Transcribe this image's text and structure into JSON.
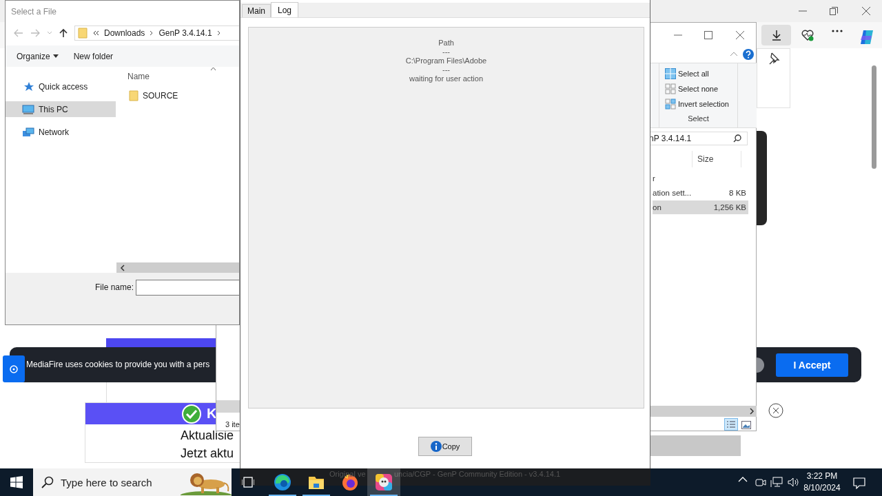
{
  "browser": {
    "cookie_banner": {
      "text": "MediaFire uses cookies to provide you with a pers",
      "accept_button": "I Accept"
    },
    "ad": {
      "headline": "K",
      "lines": [
        "Aktualisie",
        "Jetzt aktu"
      ]
    }
  },
  "explorer_window": {
    "ribbon": {
      "items": [
        {
          "kind": "all",
          "label": "Select all"
        },
        {
          "kind": "none",
          "label": "Select none"
        },
        {
          "kind": "invert",
          "label": "Invert selection"
        }
      ],
      "group_label": "Select"
    },
    "address": "nP 3.4.14.1",
    "size_column": "Size",
    "rows": [
      {
        "name": "r",
        "selected": false
      },
      {
        "name": "ation sett...",
        "size": "8 KB",
        "selected": false
      },
      {
        "name": "on",
        "size": "1,256 KB",
        "selected": true
      }
    ],
    "status": "3 ite"
  },
  "file_dialog": {
    "title": "Select a File",
    "breadcrumb": [
      "Downloads",
      "GenP 3.4.14.1"
    ],
    "toolbar": {
      "organize": "Organize",
      "new_folder": "New folder"
    },
    "nav": [
      {
        "kind": "star",
        "label": "Quick access",
        "selected": false
      },
      {
        "kind": "pc",
        "label": "This PC",
        "selected": true
      },
      {
        "kind": "network",
        "label": "Network",
        "selected": false
      }
    ],
    "column": "Name",
    "files": [
      {
        "name": "SOURCE"
      }
    ],
    "file_name_label": "File name:"
  },
  "genp": {
    "tabs": [
      {
        "label": "Main",
        "selected": false
      },
      {
        "label": "Log",
        "selected": true
      }
    ],
    "log_lines": [
      "Path",
      "---",
      "C:\\Program Files\\Adobe",
      "---",
      "waiting for user action"
    ],
    "copy_button": "Copy",
    "status": [
      "Original ve",
      "uncia/CGP - GenP Community Edition - v3.4.14.1"
    ]
  },
  "taskbar": {
    "search_placeholder": "Type here to search",
    "apps": [
      {
        "kind": "edge",
        "running": true,
        "selected": false
      },
      {
        "kind": "folder",
        "running": true,
        "selected": false
      },
      {
        "kind": "firefox",
        "running": false,
        "selected": false
      },
      {
        "kind": "genp",
        "running": true,
        "selected": true
      }
    ],
    "time": "3:22 PM",
    "date": "8/10/2024"
  }
}
